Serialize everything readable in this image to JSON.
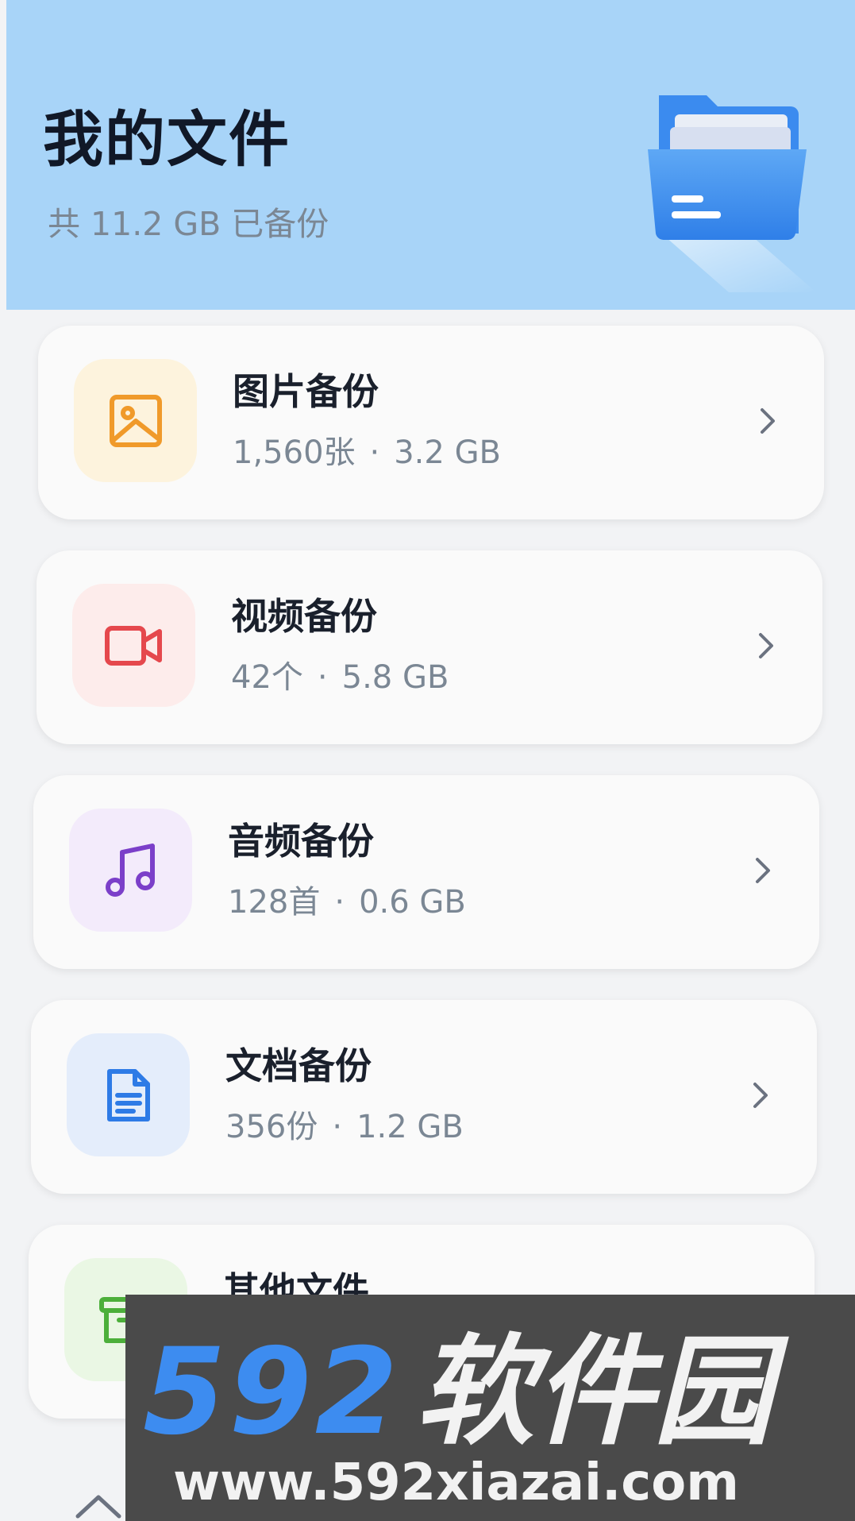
{
  "header": {
    "title": "我的文件",
    "subtitle": "共 11.2 GB 已备份"
  },
  "categories": [
    {
      "title": "图片备份",
      "count": "1,560张",
      "size": "3.2 GB",
      "icon": "image-icon",
      "icon_bg": "#fdf3dd",
      "icon_color": "#f09a2a"
    },
    {
      "title": "视频备份",
      "count": "42个",
      "size": "5.8 GB",
      "icon": "video-camera-icon",
      "icon_bg": "#fdeceb",
      "icon_color": "#e5484d"
    },
    {
      "title": "音频备份",
      "count": "128首",
      "size": "0.6 GB",
      "icon": "music-note-icon",
      "icon_bg": "#f3ebfb",
      "icon_color": "#7b3fc9"
    },
    {
      "title": "文档备份",
      "count": "356份",
      "size": "1.2 GB",
      "icon": "document-icon",
      "icon_bg": "#e4edfb",
      "icon_color": "#2e7be6"
    },
    {
      "title": "其他文件",
      "count": "",
      "size": "",
      "icon": "archive-box-icon",
      "icon_bg": "#eaf7e4",
      "icon_color": "#4caf3a"
    }
  ],
  "separator": "·",
  "watermark": {
    "number": "592",
    "name": "软件园",
    "url": "www.592xiazai.com"
  }
}
